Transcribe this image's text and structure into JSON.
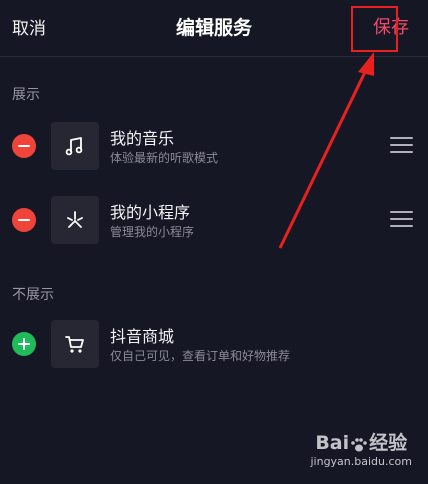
{
  "header": {
    "cancel": "取消",
    "title": "编辑服务",
    "save": "保存"
  },
  "sections": {
    "shown": {
      "label": "展示"
    },
    "hidden": {
      "label": "不展示"
    }
  },
  "items": [
    {
      "title": "我的音乐",
      "subtitle": "体验最新的听歌模式",
      "icon": "music-note-icon",
      "action": "remove"
    },
    {
      "title": "我的小程序",
      "subtitle": "管理我的小程序",
      "icon": "mini-program-icon",
      "action": "remove"
    },
    {
      "title": "抖音商城",
      "subtitle": "仅自己可见，查看订单和好物推荐",
      "icon": "shopping-cart-icon",
      "action": "add"
    }
  ],
  "watermark": {
    "main_left": "Bai",
    "main_right": "经验",
    "url": "jingyan.baidu.com"
  },
  "colors": {
    "background": "#161724",
    "save_accent": "#f04b6a",
    "remove": "#f0443a",
    "add": "#1fba5a",
    "annotation": "#e8211f"
  }
}
